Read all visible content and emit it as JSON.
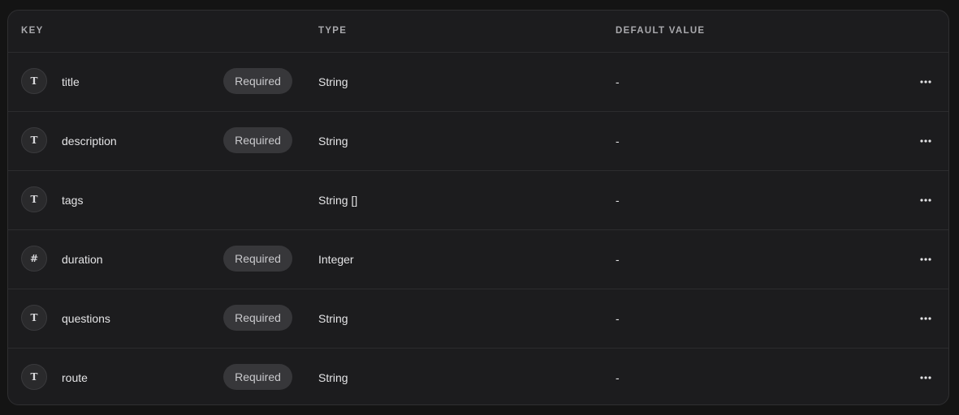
{
  "table": {
    "headers": {
      "key": "KEY",
      "type": "TYPE",
      "default_value": "DEFAULT VALUE"
    },
    "rows": [
      {
        "icon": "text-type-icon",
        "icon_glyph": "T",
        "key": "title",
        "badge": "Required",
        "type": "String",
        "default": "-"
      },
      {
        "icon": "text-type-icon",
        "icon_glyph": "T",
        "key": "description",
        "badge": "Required",
        "type": "String",
        "default": "-"
      },
      {
        "icon": "text-type-icon",
        "icon_glyph": "T",
        "key": "tags",
        "badge": "",
        "type": "String []",
        "default": "-"
      },
      {
        "icon": "number-type-icon",
        "icon_glyph": "#",
        "key": "duration",
        "badge": "Required",
        "type": "Integer",
        "default": "-"
      },
      {
        "icon": "text-type-icon",
        "icon_glyph": "T",
        "key": "questions",
        "badge": "Required",
        "type": "String",
        "default": "-"
      },
      {
        "icon": "text-type-icon",
        "icon_glyph": "T",
        "key": "route",
        "badge": "Required",
        "type": "String",
        "default": "-"
      }
    ]
  },
  "colors": {
    "background": "#141414",
    "card": "#1c1c1e",
    "badge": "#37373a",
    "text": "#e4e4e6",
    "header_text": "#a9a9ad"
  }
}
